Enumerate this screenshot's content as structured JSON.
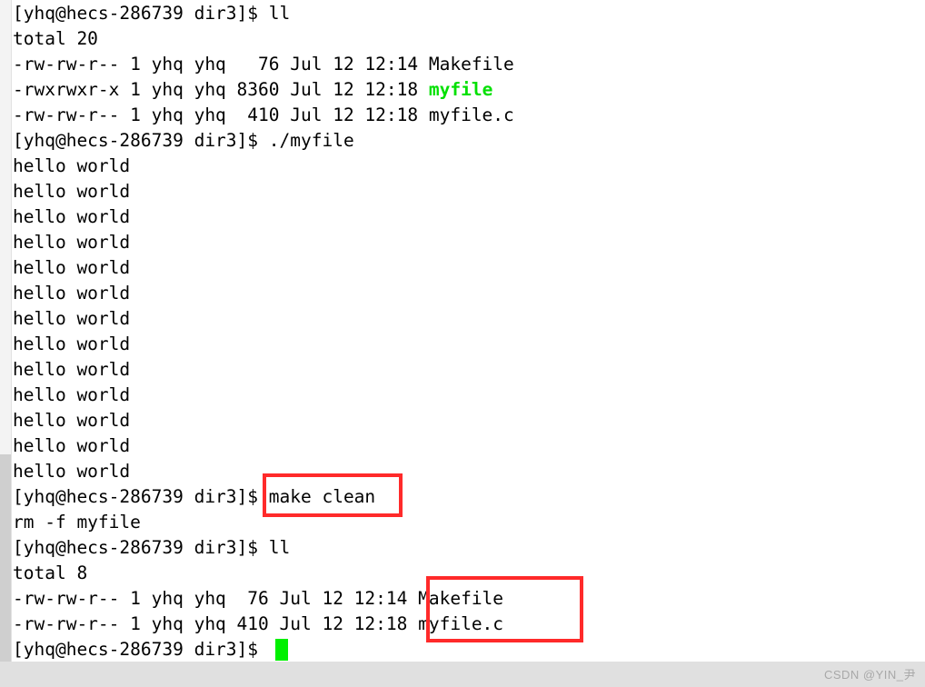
{
  "terminal": {
    "prompt": "[yhq@hecs-286739 dir3]$ ",
    "cursor_color": "#00f000",
    "text_color": "#000000",
    "background": "#ffffff",
    "highlight_color": "#00e000",
    "lines": [
      {
        "id": "l01",
        "text": "[yhq@hecs-286739 dir3]$ ll"
      },
      {
        "id": "l02",
        "text": "total 20"
      },
      {
        "id": "l03",
        "text": "-rw-rw-r-- 1 yhq yhq   76 Jul 12 12:14 Makefile"
      },
      {
        "id": "l04",
        "pre": "-rwxrwxr-x 1 yhq yhq 8360 Jul 12 12:18 ",
        "green": "myfile"
      },
      {
        "id": "l05",
        "text": "-rw-rw-r-- 1 yhq yhq  410 Jul 12 12:18 myfile.c"
      },
      {
        "id": "l06",
        "text": "[yhq@hecs-286739 dir3]$ ./myfile"
      },
      {
        "id": "l07",
        "text": "hello world"
      },
      {
        "id": "l08",
        "text": "hello world"
      },
      {
        "id": "l09",
        "text": "hello world"
      },
      {
        "id": "l10",
        "text": "hello world"
      },
      {
        "id": "l11",
        "text": "hello world"
      },
      {
        "id": "l12",
        "text": "hello world"
      },
      {
        "id": "l13",
        "text": "hello world"
      },
      {
        "id": "l14",
        "text": "hello world"
      },
      {
        "id": "l15",
        "text": "hello world"
      },
      {
        "id": "l16",
        "text": "hello world"
      },
      {
        "id": "l17",
        "text": "hello world"
      },
      {
        "id": "l18",
        "text": "hello world"
      },
      {
        "id": "l19",
        "text": "hello world"
      },
      {
        "id": "l20",
        "text": "[yhq@hecs-286739 dir3]$ make clean"
      },
      {
        "id": "l21",
        "text": "rm -f myfile"
      },
      {
        "id": "l22",
        "text": "[yhq@hecs-286739 dir3]$ ll"
      },
      {
        "id": "l23",
        "text": "total 8"
      },
      {
        "id": "l24",
        "text": "-rw-rw-r-- 1 yhq yhq  76 Jul 12 12:14 Makefile"
      },
      {
        "id": "l25",
        "text": "-rw-rw-r-- 1 yhq yhq 410 Jul 12 12:18 myfile.c"
      },
      {
        "id": "l26",
        "text": "[yhq@hecs-286739 dir3]$ "
      }
    ]
  },
  "annotations": {
    "color": "#ff2a2a",
    "boxes": [
      {
        "id": "make-clean",
        "target": "make clean"
      },
      {
        "id": "files",
        "target": "Makefile myfile.c"
      }
    ]
  },
  "watermark": {
    "text": "CSDN @YIN_尹"
  }
}
